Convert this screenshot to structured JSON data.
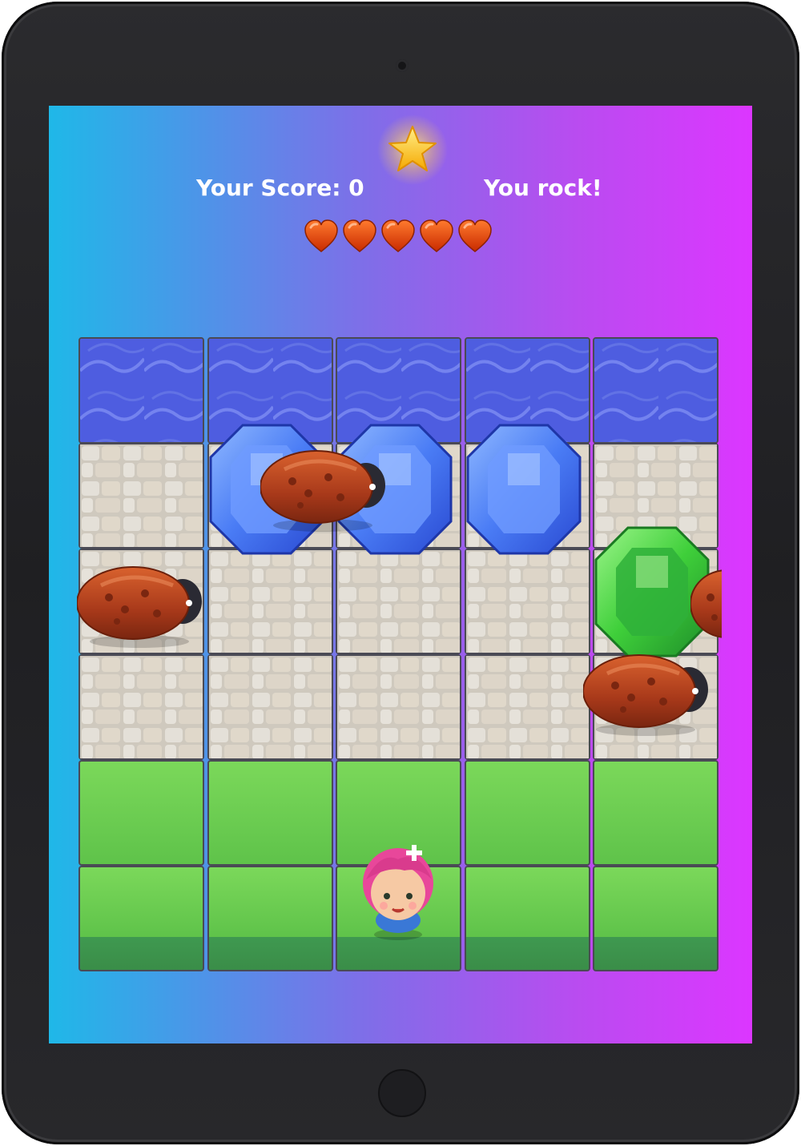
{
  "hud": {
    "score_label": "Your Score: 0",
    "status_message": "You rock!",
    "lives": 5
  },
  "board": {
    "columns": 5,
    "rows": [
      "water",
      "stone",
      "stone",
      "stone",
      "grass",
      "grass"
    ],
    "gems": [
      {
        "color": "blue",
        "row": 1,
        "col": 1
      },
      {
        "color": "blue",
        "row": 1,
        "col": 2
      },
      {
        "color": "blue",
        "row": 1,
        "col": 3
      },
      {
        "color": "green",
        "row": 2,
        "col": 4
      }
    ],
    "enemies": [
      {
        "type": "bug",
        "row": 1
      },
      {
        "type": "bug",
        "row": 2
      },
      {
        "type": "bug",
        "row": 2
      },
      {
        "type": "bug",
        "row": 3
      }
    ],
    "player": {
      "character": "pink-haired-girl",
      "row": 5,
      "col": 2
    }
  },
  "colors": {
    "gradient_left": "#1fb8e8",
    "gradient_right": "#dc36ff",
    "water": "#4e5de0",
    "stone": "#d5d0c6",
    "grass": "#6ccd50",
    "heart": "#e8400a",
    "gem_blue": "#4a7cf5",
    "gem_green": "#3fcf3a",
    "bug": "#b8441c"
  },
  "icons": [
    "star-icon",
    "heart-icon",
    "bug-icon",
    "gem-icon"
  ]
}
